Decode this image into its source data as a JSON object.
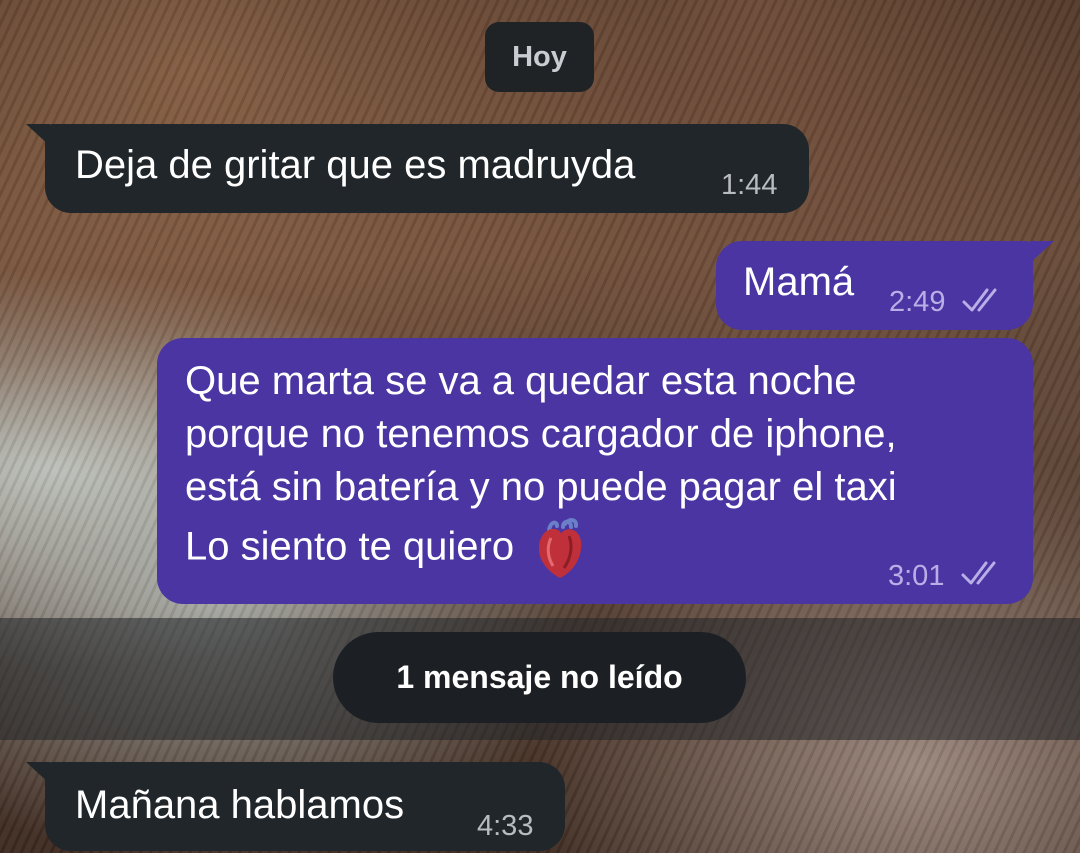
{
  "date_separator": "Hoy",
  "messages": [
    {
      "text": "Deja de gritar que es madruyda",
      "time": "1:44"
    },
    {
      "text": "Mamá",
      "time": "2:49"
    },
    {
      "lines": [
        "Que marta se va a quedar esta noche",
        "porque no tenemos cargador de iphone,",
        "está sin batería y no puede pagar el taxi",
        "Lo siento te quiero"
      ],
      "time": "3:01",
      "emoji": "anatomical-heart-icon"
    },
    {
      "text": "Mañana hablamos",
      "time": "4:33"
    }
  ],
  "unread_banner": "1 mensaje no leído",
  "colors": {
    "incoming": "#20262a",
    "outgoing": "#4a35a3",
    "chip": "#1f2326"
  }
}
